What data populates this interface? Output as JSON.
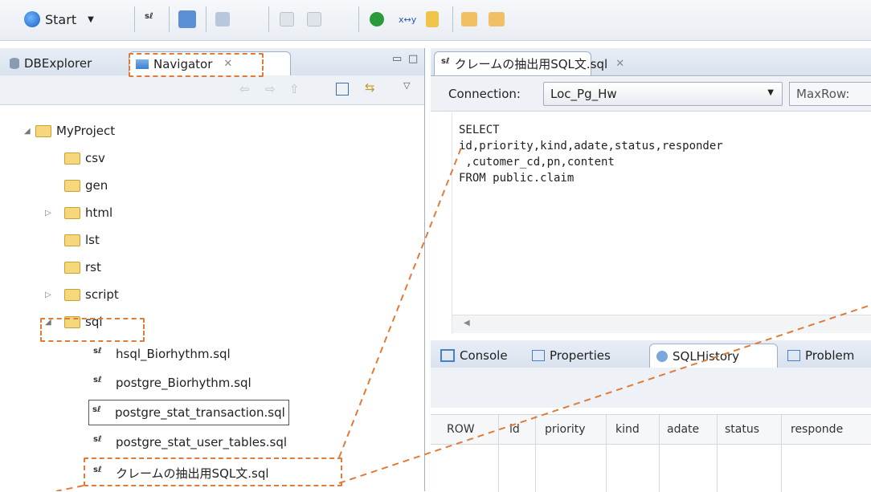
{
  "toolbar": {
    "start_label": "Start",
    "icons": [
      "run-icon",
      "sql-icon",
      "list-icon",
      "save-icon",
      "disabled-icon-1",
      "disabled-icon-2",
      "play-icon",
      "xy-icon",
      "doc-icon",
      "import-icon",
      "export-icon"
    ]
  },
  "left_panel": {
    "tabs": [
      {
        "label": "DBExplorer",
        "icon": "database-icon"
      },
      {
        "label": "Navigator",
        "icon": "navigator-icon"
      }
    ],
    "tree": {
      "root": "MyProject",
      "folders": [
        "csv",
        "gen",
        "html",
        "lst",
        "rst",
        "script",
        "sql"
      ],
      "sql_files": [
        "hsql_Biorhythm.sql",
        "postgre_Biorhythm.sql",
        "postgre_stat_transaction.sql",
        "postgre_stat_user_tables.sql",
        "クレームの抽出用SQL文.sql"
      ]
    }
  },
  "editor": {
    "tab_title": "クレームの抽出用SQL文.sql",
    "connection_label": "Connection:",
    "connection_value": "Loc_Pg_Hw",
    "maxrow_label": "MaxRow:",
    "code": [
      "SELECT",
      "id,priority,kind,adate,status,responder",
      " ,cutomer_cd,pn,content",
      "FROM public.claim"
    ]
  },
  "bottom_panel": {
    "tabs": [
      "Console",
      "Properties",
      "SQLHistory",
      "Problem"
    ],
    "columns": [
      "ROW",
      "id",
      "priority",
      "kind",
      "adate",
      "status",
      "responde"
    ]
  },
  "colors": {
    "accent": "#e07b39",
    "tab_border": "#9fb0c6",
    "folder": "#f6d77b"
  }
}
